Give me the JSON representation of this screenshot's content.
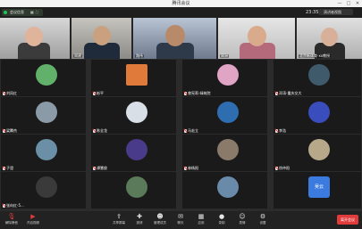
{
  "window": {
    "title": "腾讯会议"
  },
  "topbar": {
    "meeting_id": "会议信息",
    "time": "23:35",
    "speaker_view": "演讲者视图"
  },
  "video_strip": [
    {
      "name": "",
      "bg": "#cfcfcf"
    },
    {
      "name": "周建 ",
      "bg": "#b7b5b0"
    },
    {
      "name": "路伟",
      "bg": "#9aa7bb"
    },
    {
      "name": "周洲",
      "bg": "#d6d6d6"
    },
    {
      "name": "北京新体育-xx教授",
      "bg": "#cdcdcd"
    }
  ],
  "participants": [
    {
      "name": "刘凤红",
      "color": "#62b16a"
    },
    {
      "name": "彬平",
      "color": "#e07a3a"
    },
    {
      "name": "曾宪莉-绿筑院",
      "color": "#e0a4c4"
    },
    {
      "name": "邓涛-重庆交大",
      "color": "#3e5a6b"
    },
    {
      "name": "李浩",
      "color": "#3a4dbd"
    },
    {
      "name": "梁腾杰",
      "color": "#8a9aa6"
    },
    {
      "name": "陈全龙",
      "color": "#d9dfe6"
    },
    {
      "name": "马宏立",
      "color": "#2f6db1"
    },
    {
      "name": "林杨阳",
      "color": "#8a7a6a"
    },
    {
      "name": "徐仲阳",
      "color": "#b7a88a"
    },
    {
      "name": "子澄",
      "color": "#6b8fa6"
    },
    {
      "name": "谭慧俊",
      "color": "#4a3a8a"
    },
    {
      "name": "廖桂文",
      "color": "#7a8a9a"
    },
    {
      "name": "徐茂文-西南大学",
      "color": "#6a6a4a"
    },
    {
      "name": "宋志平",
      "color": "#c2b8aa"
    },
    {
      "name": "张向红-5...",
      "color": "#3a3a3a"
    },
    {
      "name": "",
      "color": "#5a7a5a"
    },
    {
      "name": "",
      "color": "#6a8aaa"
    },
    {
      "name": "",
      "color": "#3b7be0",
      "label": "吴云"
    }
  ],
  "toolbar": {
    "mic": "解除静音",
    "video": "开启视频",
    "items": [
      "共享屏幕",
      "邀请",
      "管理成员",
      "聊天",
      "应用",
      "录制",
      "表情",
      "设置"
    ],
    "leave": "离开会议"
  }
}
